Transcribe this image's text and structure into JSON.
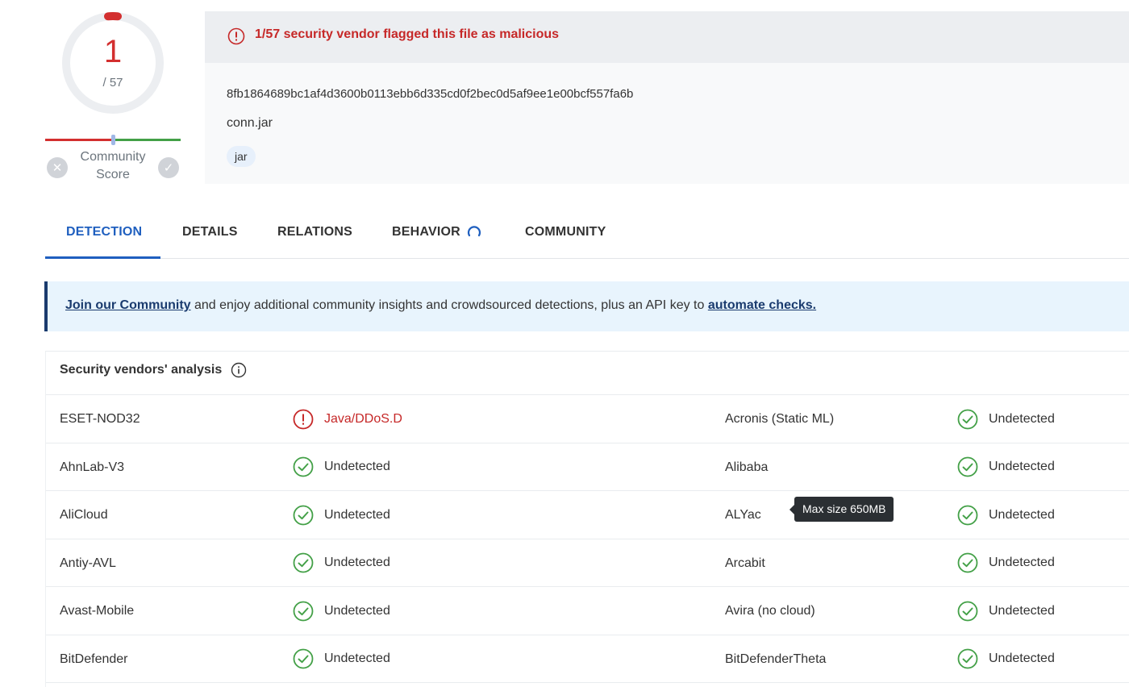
{
  "score": {
    "detections": "1",
    "total": "/ 57",
    "community_label": "Community Score"
  },
  "file": {
    "alert": "1/57 security vendor flagged this file as malicious",
    "hash": "8fb1864689bc1af4d3600b0113ebb6d335cd0f2bec0d5af9ee1e00bcf557fa6b",
    "name": "conn.jar",
    "tag": "jar"
  },
  "tabs": [
    {
      "label": "DETECTION",
      "active": true
    },
    {
      "label": "DETAILS"
    },
    {
      "label": "RELATIONS"
    },
    {
      "label": "BEHAVIOR"
    },
    {
      "label": "COMMUNITY"
    }
  ],
  "banner": {
    "link1": "Join our Community",
    "text": " and enjoy additional community insights and crowdsourced detections, plus an API key to ",
    "link2": "automate checks."
  },
  "section": {
    "title": "Security vendors' analysis"
  },
  "vendors": [
    {
      "left": "ESET-NOD32",
      "left_result": "Java/DDoS.D",
      "left_status": "malicious",
      "right": "Acronis (Static ML)",
      "right_result": "Undetected"
    },
    {
      "left": "AhnLab-V3",
      "left_result": "Undetected",
      "right": "Alibaba",
      "right_result": "Undetected"
    },
    {
      "left": "AliCloud",
      "left_result": "Undetected",
      "right": "ALYac",
      "right_result": "Undetected"
    },
    {
      "left": "Antiy-AVL",
      "left_result": "Undetected",
      "right": "Arcabit",
      "right_result": "Undetected"
    },
    {
      "left": "Avast-Mobile",
      "left_result": "Undetected",
      "right": "Avira (no cloud)",
      "right_result": "Undetected"
    },
    {
      "left": "BitDefender",
      "left_result": "Undetected",
      "right": "BitDefenderTheta",
      "right_result": "Undetected"
    }
  ],
  "tooltip": "Max size 650MB",
  "colors": {
    "malicious": "#c62828",
    "clean": "#43a047",
    "accent": "#1f5fbf"
  }
}
